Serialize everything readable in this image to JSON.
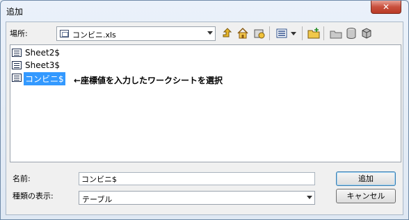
{
  "window": {
    "title": "追加",
    "close_label": "✕"
  },
  "location": {
    "label": "場所:",
    "value": "コンビニ.xls"
  },
  "toolbar": [
    {
      "name": "up-level-icon",
      "glyph": "⬆"
    },
    {
      "name": "home-icon",
      "glyph": "⌂"
    },
    {
      "name": "connect-folder-icon",
      "glyph": "▣"
    },
    {
      "name": "view-list-icon",
      "glyph": "☷"
    },
    {
      "name": "view-dropdown-icon",
      "glyph": "▾"
    },
    {
      "name": "new-folder-icon",
      "glyph": "✚"
    },
    {
      "name": "folder-options-icon",
      "glyph": "▭"
    },
    {
      "name": "database-icon",
      "glyph": "⬢"
    },
    {
      "name": "catalog-icon",
      "glyph": "⬣"
    }
  ],
  "items": [
    {
      "label": "Sheet2$",
      "selected": false
    },
    {
      "label": "Sheet3$",
      "selected": false
    },
    {
      "label": "コンビニ$",
      "selected": true
    }
  ],
  "annotation": "←座標値を入力したワークシートを選択",
  "form": {
    "name_label": "名前:",
    "name_value": "コンビニ$",
    "type_label": "種類の表示:",
    "type_value": "テーブル"
  },
  "buttons": {
    "add": "追加",
    "cancel": "キャンセル"
  },
  "colors": {
    "selection": "#3399ff",
    "close": "#c8503d"
  }
}
